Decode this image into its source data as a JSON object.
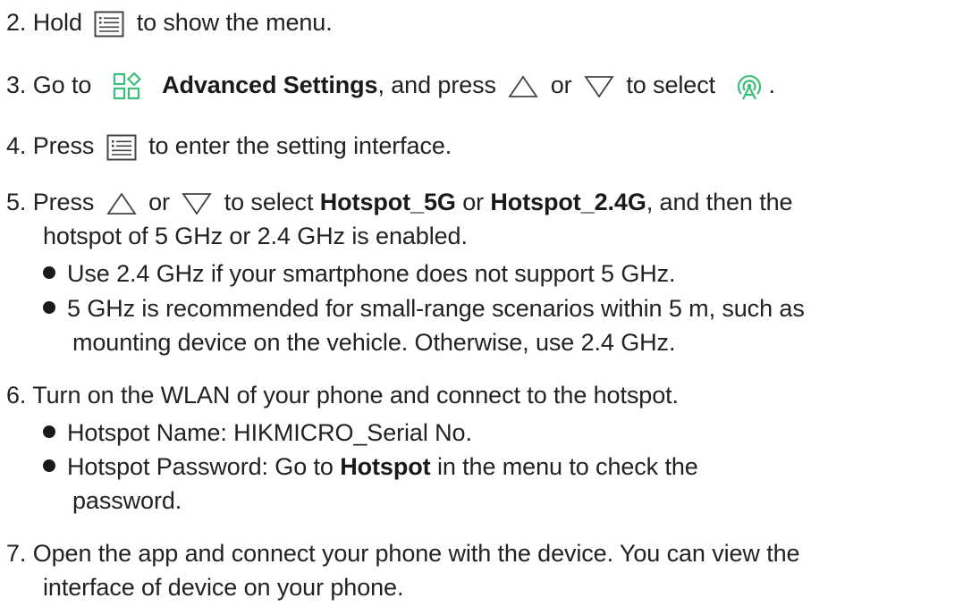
{
  "step2": {
    "num": "2.",
    "pre": "Hold",
    "post": "to show the menu.",
    "icon": "menu-list-icon"
  },
  "step3": {
    "num": "3.",
    "pre": "Go to",
    "bold": "Advanced Settings",
    "mid1": ", and press",
    "or": "or",
    "mid2": "to select",
    "end": ".",
    "icons": [
      "advanced-settings-icon",
      "up-triangle-icon",
      "down-triangle-icon",
      "hotspot-icon"
    ],
    "accent": "#3dbf7a"
  },
  "step4": {
    "num": "4.",
    "pre": "Press",
    "post": "to enter the setting interface.",
    "icon": "menu-list-icon"
  },
  "step5": {
    "num": "5.",
    "pre": "Press",
    "or1": "or",
    "mid": "to select",
    "bold1": "Hotspot_5G",
    "or2": "or",
    "bold2": "Hotspot_2.4G",
    "tail": ", and then the",
    "line2": "hotspot of 5 GHz or 2.4 GHz is enabled.",
    "bullets": [
      {
        "line1": "Use 2.4 GHz if your smartphone does not support 5 GHz."
      },
      {
        "line1": "5 GHz is recommended for small-range scenarios within 5 m, such as",
        "line2": "mounting device on the vehicle. Otherwise, use 2.4 GHz."
      }
    ]
  },
  "step6": {
    "num": "6.",
    "text": "Turn on the WLAN of your phone and connect to the hotspot.",
    "bullet1": "Hotspot Name: HIKMICRO_Serial No.",
    "bullet2_pre": "Hotspot Password: Go to",
    "bullet2_bold": "Hotspot",
    "bullet2_post": "in the menu to check the",
    "bullet2_line2": "password."
  },
  "step7": {
    "num": "7.",
    "line1": "Open the app and connect your phone with the device. You can view the",
    "line2": "interface of device on your phone."
  }
}
